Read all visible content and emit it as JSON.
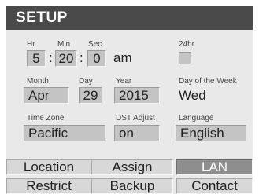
{
  "header": {
    "title": "SETUP"
  },
  "time": {
    "hr_label": "Hr",
    "min_label": "Min",
    "sec_label": "Sec",
    "hr": "5",
    "min": "20",
    "sec": "0",
    "sep1": ":",
    "sep2": ":",
    "ampm": "am",
    "h24_label": "24hr",
    "h24_checked": false
  },
  "date": {
    "month_label": "Month",
    "day_label": "Day",
    "year_label": "Year",
    "dow_label": "Day of the Week",
    "month": "Apr",
    "day": "29",
    "year": "2015",
    "dow": "Wed"
  },
  "settings": {
    "timezone_label": "Time Zone",
    "dst_label": "DST Adjust",
    "language_label": "Language",
    "timezone": "Pacific",
    "dst": "on",
    "language": "English"
  },
  "tabs": [
    {
      "label": "Location",
      "active": false
    },
    {
      "label": "Assign",
      "active": false
    },
    {
      "label": "LAN",
      "active": true
    },
    {
      "label": "Restrict",
      "active": false
    },
    {
      "label": "Backup",
      "active": false
    },
    {
      "label": "Contact",
      "active": false
    }
  ]
}
